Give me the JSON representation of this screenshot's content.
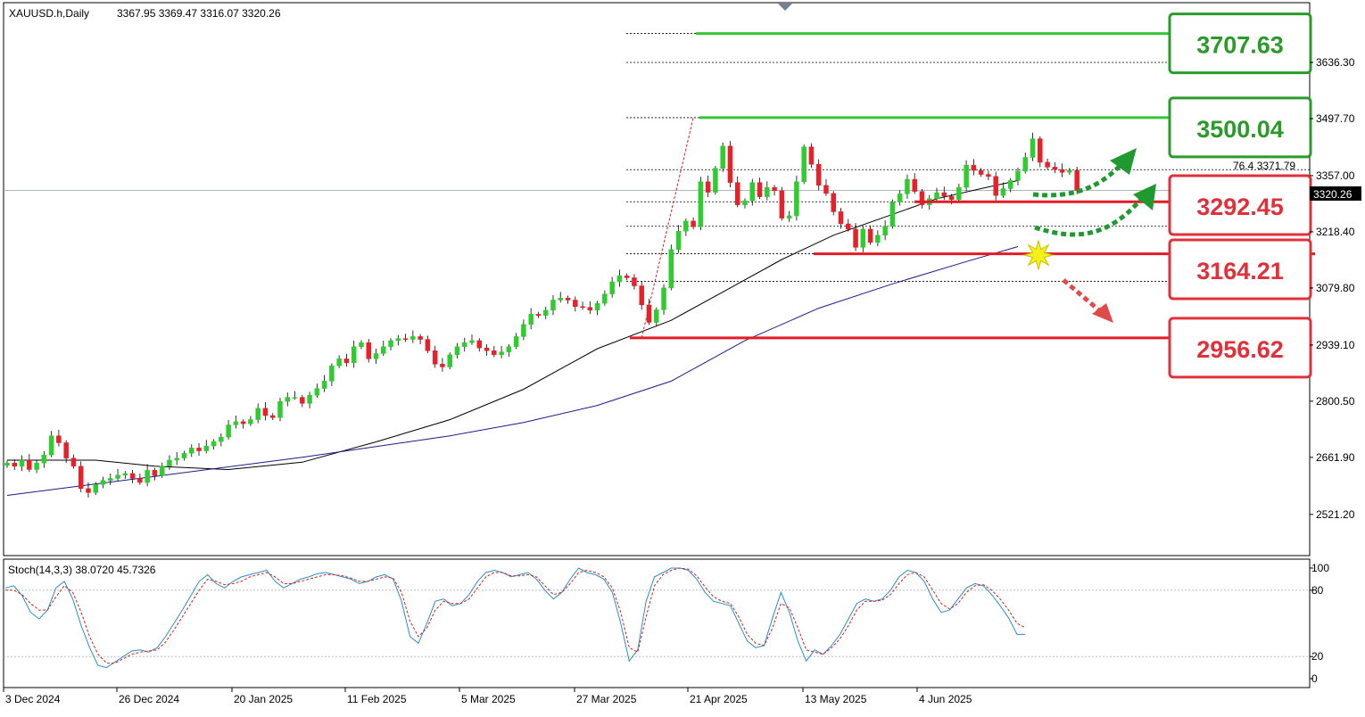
{
  "header": {
    "symbol": "XAUUSD.h,Daily",
    "ohlc": "3367.95 3369.47 3316.07 3320.26"
  },
  "indicator": {
    "label": "Stoch(14,3,3) 38.0720 45.7326"
  },
  "fib_label": "76.4 3371.79",
  "current_price": "3320.26",
  "colors": {
    "bull": "#2ecc2e",
    "bear": "#e8202a",
    "ma_short": "#000000",
    "ma_long": "#1a1a8c",
    "target": "#3ad63a",
    "support": "#e01c24",
    "stoch_main": "#2a8fc8",
    "stoch_signal": "#d42020"
  },
  "chart_data": {
    "type": "candlestick",
    "symbol": "XAUUSD.h",
    "timeframe": "Daily",
    "y_ticks": [
      "3636.30",
      "3497.70",
      "3357.00",
      "3218.40",
      "3079.80",
      "2939.10",
      "2800.50",
      "2661.90",
      "2521.20"
    ],
    "x_ticks": [
      "3 Dec 2024",
      "26 Dec 2024",
      "20 Jan 2025",
      "11 Feb 2025",
      "5 Mar 2025",
      "27 Mar 2025",
      "21 Apr 2025",
      "13 May 2025",
      "4 Jun 2025"
    ],
    "ylim": [
      2460,
      3760
    ],
    "last_close": 3320.26,
    "levels": [
      {
        "label": "3707.63",
        "value": 3707.63,
        "kind": "target"
      },
      {
        "label": "3500.04",
        "value": 3500.04,
        "kind": "target"
      },
      {
        "label": "3292.45",
        "value": 3292.45,
        "kind": "support"
      },
      {
        "label": "3164.21",
        "value": 3164.21,
        "kind": "support"
      },
      {
        "label": "2956.62",
        "value": 2956.62,
        "kind": "support"
      }
    ],
    "fib_levels": [
      3707.63,
      3636.3,
      3500.04,
      3371.79,
      3292.45,
      3232,
      3164.21,
      3096
    ],
    "closes": [
      2648,
      2640,
      2655,
      2632,
      2648,
      2668,
      2715,
      2698,
      2660,
      2640,
      2585,
      2575,
      2595,
      2605,
      2610,
      2618,
      2622,
      2610,
      2600,
      2630,
      2617,
      2640,
      2655,
      2660,
      2672,
      2685,
      2678,
      2690,
      2701,
      2712,
      2742,
      2750,
      2745,
      2755,
      2783,
      2765,
      2760,
      2800,
      2810,
      2810,
      2795,
      2815,
      2832,
      2850,
      2888,
      2905,
      2895,
      2935,
      2945,
      2905,
      2918,
      2935,
      2950,
      2955,
      2953,
      2960,
      2953,
      2925,
      2892,
      2885,
      2915,
      2935,
      2945,
      2950,
      2932,
      2925,
      2915,
      2922,
      2935,
      2960,
      2990,
      3015,
      3012,
      3025,
      3050,
      3055,
      3050,
      3034,
      3032,
      3025,
      3042,
      3065,
      3095,
      3110,
      3105,
      3085,
      3038,
      2995,
      3026,
      3080,
      3175,
      3220,
      3245,
      3231,
      3342,
      3316,
      3375,
      3430,
      3340,
      3285,
      3295,
      3340,
      3305,
      3328,
      3320,
      3252,
      3258,
      3342,
      3428,
      3385,
      3333,
      3313,
      3268,
      3238,
      3225,
      3180,
      3225,
      3192,
      3210,
      3232,
      3292,
      3312,
      3348,
      3318,
      3285,
      3300,
      3315,
      3306,
      3298,
      3328,
      3383,
      3370,
      3360,
      3355,
      3308,
      3325,
      3345,
      3368,
      3402,
      3448,
      3390,
      3378,
      3372,
      3365,
      3370,
      3320.26
    ],
    "ma_short": [
      [
        0,
        2655
      ],
      [
        12,
        2655
      ],
      [
        20,
        2640
      ],
      [
        30,
        2632
      ],
      [
        40,
        2650
      ],
      [
        50,
        2700
      ],
      [
        60,
        2755
      ],
      [
        70,
        2830
      ],
      [
        80,
        2930
      ],
      [
        90,
        3000
      ],
      [
        97,
        3070
      ],
      [
        105,
        3150
      ],
      [
        112,
        3210
      ],
      [
        119,
        3255
      ],
      [
        126,
        3300
      ],
      [
        132,
        3325
      ],
      [
        137,
        3345
      ]
    ],
    "ma_long": [
      [
        0,
        2568
      ],
      [
        20,
        2615
      ],
      [
        40,
        2662
      ],
      [
        60,
        2715
      ],
      [
        70,
        2748
      ],
      [
        80,
        2790
      ],
      [
        90,
        2850
      ],
      [
        100,
        2950
      ],
      [
        110,
        3030
      ],
      [
        120,
        3090
      ],
      [
        130,
        3145
      ],
      [
        137,
        3182
      ]
    ],
    "stochastic": {
      "label": "Stoch(14,3,3)",
      "params": [
        14,
        3,
        3
      ],
      "main_value": 38.072,
      "signal_value": 45.7326,
      "levels": [
        80,
        20
      ],
      "y_ticks": [
        "100",
        "80",
        "20",
        "0"
      ],
      "main": [
        82,
        84,
        75,
        60,
        54,
        62,
        82,
        88,
        72,
        48,
        28,
        12,
        10,
        15,
        20,
        25,
        26,
        24,
        28,
        38,
        50,
        62,
        75,
        88,
        94,
        86,
        82,
        88,
        92,
        94,
        96,
        98,
        88,
        82,
        86,
        90,
        92,
        95,
        96,
        94,
        92,
        90,
        86,
        88,
        92,
        94,
        90,
        70,
        38,
        32,
        50,
        70,
        72,
        66,
        68,
        76,
        88,
        96,
        98,
        96,
        92,
        94,
        96,
        90,
        80,
        72,
        78,
        90,
        100,
        96,
        94,
        90,
        78,
        50,
        16,
        26,
        70,
        92,
        96,
        100,
        100,
        98,
        90,
        78,
        70,
        68,
        66,
        50,
        34,
        28,
        30,
        55,
        78,
        60,
        34,
        16,
        26,
        22,
        30,
        40,
        54,
        68,
        72,
        70,
        72,
        80,
        92,
        98,
        96,
        88,
        72,
        60,
        62,
        72,
        82,
        86,
        84,
        76,
        66,
        55,
        40,
        40
      ],
      "signal": [
        80,
        80,
        76,
        68,
        62,
        62,
        74,
        84,
        78,
        60,
        38,
        22,
        14,
        14,
        18,
        22,
        24,
        25,
        26,
        33,
        44,
        56,
        68,
        80,
        90,
        88,
        85,
        86,
        88,
        92,
        94,
        96,
        92,
        86,
        86,
        88,
        90,
        92,
        94,
        94,
        93,
        91,
        88,
        88,
        90,
        92,
        91,
        78,
        52,
        38,
        46,
        62,
        70,
        68,
        68,
        72,
        82,
        92,
        96,
        96,
        93,
        93,
        94,
        92,
        84,
        76,
        78,
        86,
        96,
        98,
        96,
        92,
        82,
        60,
        28,
        24,
        56,
        84,
        94,
        98,
        100,
        99,
        93,
        83,
        74,
        70,
        68,
        56,
        40,
        32,
        30,
        46,
        68,
        64,
        46,
        26,
        24,
        22,
        28,
        36,
        48,
        62,
        70,
        70,
        71,
        76,
        86,
        94,
        96,
        92,
        80,
        68,
        63,
        68,
        78,
        84,
        85,
        80,
        72,
        62,
        50,
        46
      ]
    },
    "projections": [
      {
        "direction": "up",
        "label": "bullish projection"
      },
      {
        "direction": "up",
        "label": "bullish projection"
      },
      {
        "direction": "down",
        "label": "bearish projection"
      }
    ]
  }
}
